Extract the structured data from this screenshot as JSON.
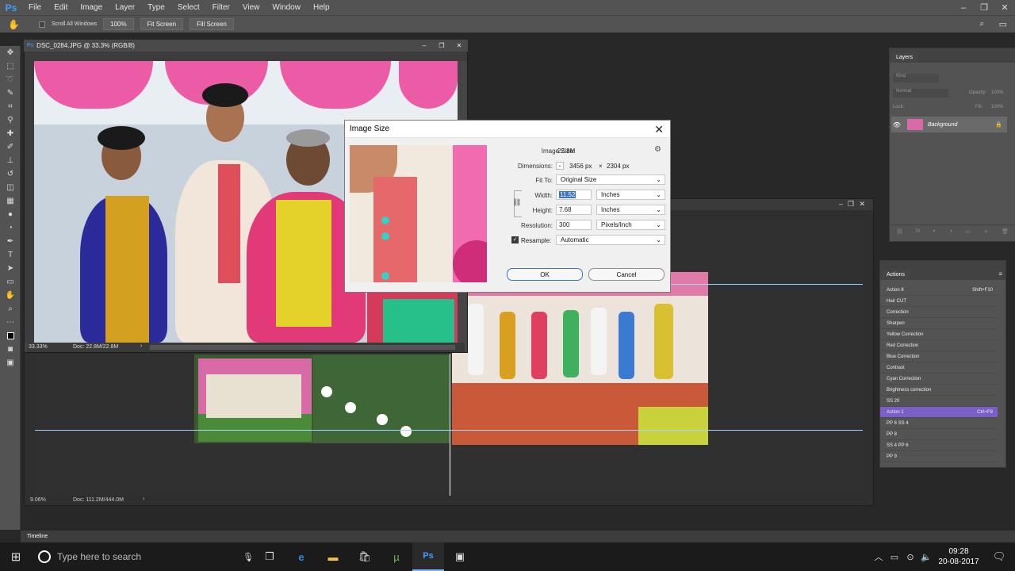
{
  "menubar": {
    "logo": "Ps",
    "items": [
      "File",
      "Edit",
      "Image",
      "Layer",
      "Type",
      "Select",
      "Filter",
      "View",
      "Window",
      "Help"
    ]
  },
  "options": {
    "scroll_all": "Scroll All Windows",
    "zoom_100": "100%",
    "fit_screen": "Fit Screen",
    "fill_screen": "Fill Screen"
  },
  "doc1": {
    "title": "DSC_0284.JPG @ 33.3% (RGB/8)",
    "zoom": "33.33%",
    "doc_info": "Doc: 22.8M/22.8M"
  },
  "doc2": {
    "zoom": "9.06%",
    "doc_info": "Doc: 111.2M/444.0M"
  },
  "dialog": {
    "title": "Image Size",
    "image_size_label": "Image Size:",
    "image_size_value": "22.8M",
    "dimensions_label": "Dimensions:",
    "dimensions_w": "3456 px",
    "dimensions_x": "×",
    "dimensions_h": "2304 px",
    "fit_to_label": "Fit To:",
    "fit_to_value": "Original Size",
    "width_label": "Width:",
    "width_value": "11.52",
    "width_unit": "Inches",
    "height_label": "Height:",
    "height_value": "7.68",
    "height_unit": "Inches",
    "resolution_label": "Resolution:",
    "resolution_value": "300",
    "resolution_unit": "Pixels/Inch",
    "resample_label": "Resample:",
    "resample_value": "Automatic",
    "ok": "OK",
    "cancel": "Cancel"
  },
  "layers": {
    "tab": "Layers",
    "kind": "Kind",
    "mode": "Normal",
    "opacity_label": "Opacity:",
    "opacity_value": "100%",
    "lock_label": "Lock:",
    "fill_label": "Fill:",
    "fill_value": "100%",
    "layer_name": "Background"
  },
  "actions": {
    "tab": "Actions",
    "items": [
      {
        "name": "Action 8",
        "key": "Shift+F10"
      },
      {
        "name": "Hair CUT",
        "key": ""
      },
      {
        "name": "Correction",
        "key": ""
      },
      {
        "name": "Sharpen",
        "key": ""
      },
      {
        "name": "Yellow Correction",
        "key": ""
      },
      {
        "name": "Red Correction",
        "key": ""
      },
      {
        "name": "Blue Correction",
        "key": ""
      },
      {
        "name": "Contrast",
        "key": ""
      },
      {
        "name": "Cyan Correction",
        "key": ""
      },
      {
        "name": "Brightness correction",
        "key": ""
      },
      {
        "name": "SS 20",
        "key": ""
      },
      {
        "name": "Action 1",
        "key": "Ctrl+F8"
      },
      {
        "name": "PP 6 SS 4",
        "key": ""
      },
      {
        "name": "PP 8",
        "key": ""
      },
      {
        "name": "SS 4 PP 6",
        "key": ""
      },
      {
        "name": "PP 9",
        "key": ""
      }
    ],
    "selected_index": 11
  },
  "timeline": {
    "label": "Timeline"
  },
  "taskbar": {
    "search_placeholder": "Type here to search",
    "time": "09:28",
    "date": "20-08-2017"
  },
  "colors": {
    "accent": "#7b5ec6",
    "ps_blue": "#3fa0ff"
  }
}
